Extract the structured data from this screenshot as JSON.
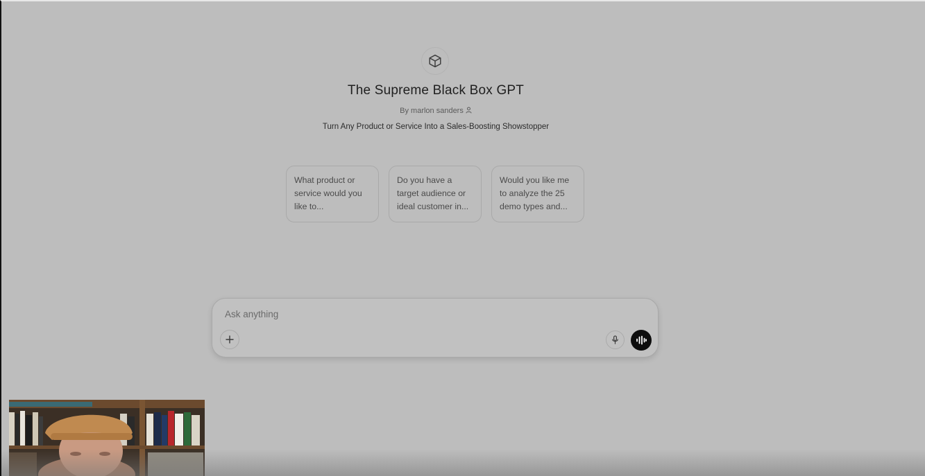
{
  "gpt": {
    "icon": "cube-icon",
    "title": "The Supreme Black Box GPT",
    "author": "By marlon sanders",
    "description": "Turn Any Product or Service Into a Sales-Boosting Showstopper"
  },
  "conversation_starters": [
    {
      "text": "What product or service would you like to..."
    },
    {
      "text": "Do you have a target audience or ideal customer in..."
    },
    {
      "text": "Would you like me to analyze the 25 demo types and..."
    }
  ],
  "composer": {
    "placeholder": "Ask anything",
    "value": "",
    "add_icon": "plus-icon",
    "mic_icon": "microphone-icon",
    "voice_icon": "voice-mode-icon"
  },
  "colors": {
    "background": "#bdbdbd",
    "voice_button": "#0d0d0d"
  }
}
